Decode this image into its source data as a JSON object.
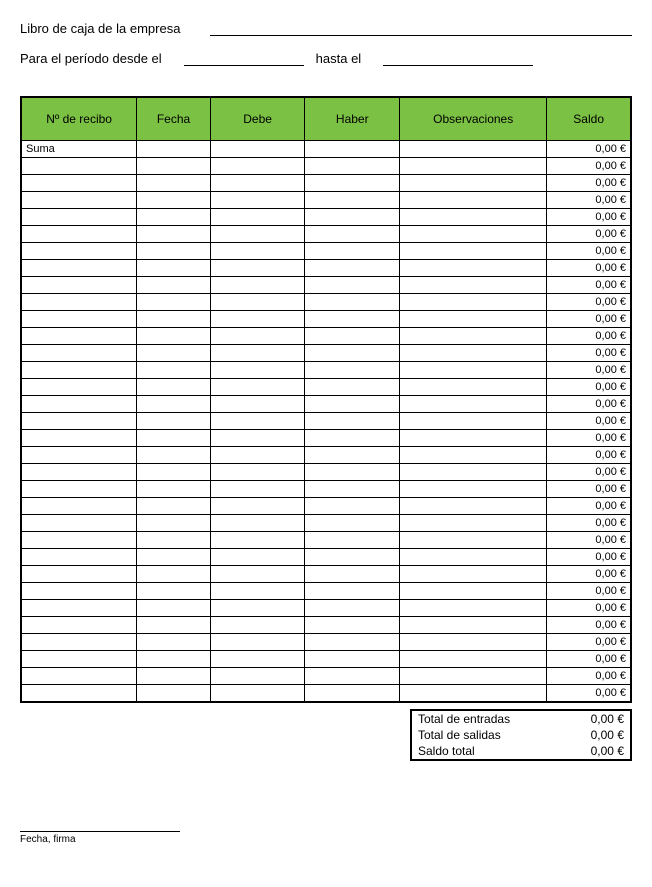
{
  "header": {
    "company_label": "Libro de caja de la empresa",
    "period_from_label": "Para el período desde el",
    "period_to_label": "hasta el"
  },
  "columns": {
    "recibo": "Nº de recibo",
    "fecha": "Fecha",
    "debe": "Debe",
    "haber": "Haber",
    "obs": "Observaciones",
    "saldo": "Saldo"
  },
  "first_row_label": "Suma",
  "row_balance": "0,00 €",
  "row_count": 33,
  "totals": {
    "entradas_label": "Total de entradas",
    "entradas_value": "0,00 €",
    "salidas_label": "Total de salidas",
    "salidas_value": "0,00 €",
    "saldo_label": "Saldo total",
    "saldo_value": "0,00 €"
  },
  "signature_label": "Fecha, firma"
}
